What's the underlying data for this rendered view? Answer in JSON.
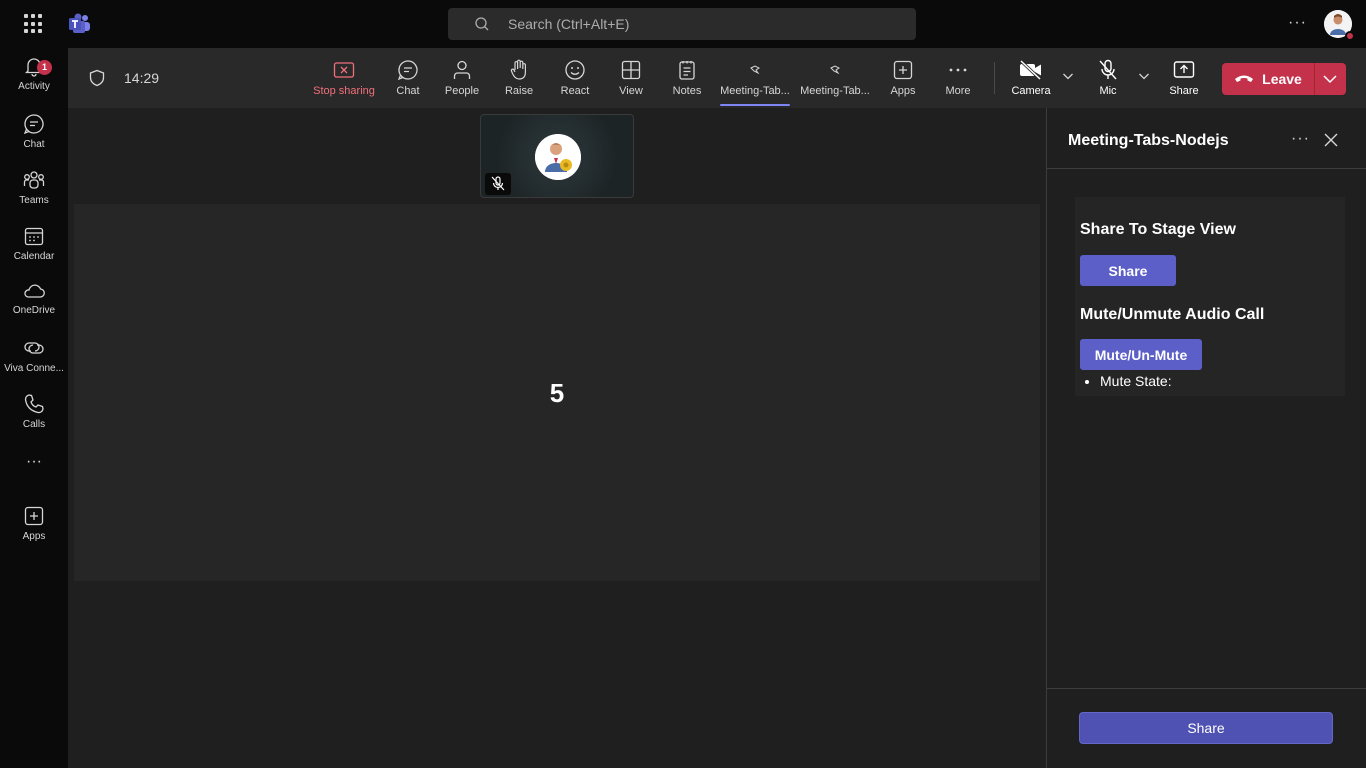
{
  "topbar": {
    "search_placeholder": "Search (Ctrl+Alt+E)",
    "more": "···"
  },
  "rail": {
    "items": [
      {
        "label": "Activity",
        "icon": "bell-icon",
        "badge": "1"
      },
      {
        "label": "Chat",
        "icon": "chat-icon"
      },
      {
        "label": "Teams",
        "icon": "teams-icon"
      },
      {
        "label": "Calendar",
        "icon": "calendar-icon"
      },
      {
        "label": "OneDrive",
        "icon": "cloud-icon"
      },
      {
        "label": "Viva Conne...",
        "icon": "viva-icon"
      },
      {
        "label": "Calls",
        "icon": "phone-icon"
      },
      {
        "label": "···",
        "icon": "more-icon"
      },
      {
        "label": "Apps",
        "icon": "add-app-icon"
      }
    ]
  },
  "meeting": {
    "time": "14:29",
    "toolbar": {
      "stop_sharing": "Stop sharing",
      "chat": "Chat",
      "people": "People",
      "raise": "Raise",
      "react": "React",
      "view": "View",
      "notes": "Notes",
      "tab1": "Meeting-Tab...",
      "tab2": "Meeting-Tab...",
      "apps": "Apps",
      "more": "More",
      "camera": "Camera",
      "mic": "Mic",
      "share": "Share",
      "leave": "Leave"
    },
    "stage_number": "5"
  },
  "panel": {
    "title": "Meeting-Tabs-Nodejs",
    "more": "···",
    "section1_heading": "Share To Stage View",
    "section1_button": "Share",
    "section2_heading": "Mute/Unmute Audio Call",
    "section2_button": "Mute/Un-Mute",
    "mute_state_label": "Mute State:",
    "footer_button": "Share"
  },
  "colors": {
    "accent": "#5b5fc7",
    "leave": "#c4314b",
    "stop_sharing": "#f1707b",
    "active_tab": "#7f85f5"
  }
}
